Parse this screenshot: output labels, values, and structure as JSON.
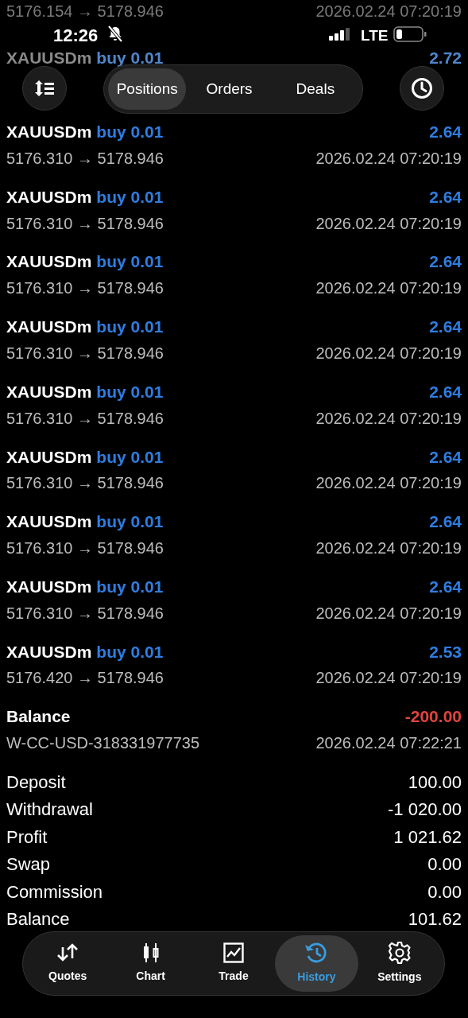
{
  "status_bar": {
    "time": "12:26",
    "network": "LTE"
  },
  "faded_top_line": {
    "price": "5176.154 → 5178.946",
    "time": "2026.02.24 07:20:19"
  },
  "faded_rows": [
    {
      "symbol": "XAUUSDm",
      "side": "buy 0.01",
      "profit": "2.72"
    }
  ],
  "tabs": [
    {
      "label": "Positions",
      "selected": true
    },
    {
      "label": "Orders",
      "selected": false
    },
    {
      "label": "Deals",
      "selected": false
    }
  ],
  "deals": [
    {
      "symbol": "XAUUSDm",
      "side": "buy 0.01",
      "profit": "2.64",
      "price": "5176.310 → 5178.946",
      "time": "2026.02.24 07:20:19",
      "kind": "trade"
    },
    {
      "symbol": "XAUUSDm",
      "side": "buy 0.01",
      "profit": "2.64",
      "price": "5176.310 → 5178.946",
      "time": "2026.02.24 07:20:19",
      "kind": "trade"
    },
    {
      "symbol": "XAUUSDm",
      "side": "buy 0.01",
      "profit": "2.64",
      "price": "5176.310 → 5178.946",
      "time": "2026.02.24 07:20:19",
      "kind": "trade"
    },
    {
      "symbol": "XAUUSDm",
      "side": "buy 0.01",
      "profit": "2.64",
      "price": "5176.310 → 5178.946",
      "time": "2026.02.24 07:20:19",
      "kind": "trade"
    },
    {
      "symbol": "XAUUSDm",
      "side": "buy 0.01",
      "profit": "2.64",
      "price": "5176.310 → 5178.946",
      "time": "2026.02.24 07:20:19",
      "kind": "trade"
    },
    {
      "symbol": "XAUUSDm",
      "side": "buy 0.01",
      "profit": "2.64",
      "price": "5176.310 → 5178.946",
      "time": "2026.02.24 07:20:19",
      "kind": "trade"
    },
    {
      "symbol": "XAUUSDm",
      "side": "buy 0.01",
      "profit": "2.64",
      "price": "5176.310 → 5178.946",
      "time": "2026.02.24 07:20:19",
      "kind": "trade"
    },
    {
      "symbol": "XAUUSDm",
      "side": "buy 0.01",
      "profit": "2.64",
      "price": "5176.310 → 5178.946",
      "time": "2026.02.24 07:20:19",
      "kind": "trade"
    },
    {
      "symbol": "XAUUSDm",
      "side": "buy 0.01",
      "profit": "2.53",
      "price": "5176.420 → 5178.946",
      "time": "2026.02.24 07:20:19",
      "kind": "trade"
    },
    {
      "symbol": "Balance",
      "profit": "-200.00",
      "price": "W-CC-USD-318331977735",
      "time": "2026.02.24 07:22:21",
      "kind": "balance"
    }
  ],
  "summary": [
    {
      "label": "Deposit",
      "value": "100.00"
    },
    {
      "label": "Withdrawal",
      "value": "-1 020.00"
    },
    {
      "label": "Profit",
      "value": "1 021.62"
    },
    {
      "label": "Swap",
      "value": "0.00"
    },
    {
      "label": "Commission",
      "value": "0.00"
    },
    {
      "label": "Balance",
      "value": "101.62"
    }
  ],
  "nav": [
    {
      "label": "Quotes",
      "selected": false
    },
    {
      "label": "Chart",
      "selected": false
    },
    {
      "label": "Trade",
      "selected": false
    },
    {
      "label": "History",
      "selected": true
    },
    {
      "label": "Settings",
      "selected": false
    }
  ]
}
